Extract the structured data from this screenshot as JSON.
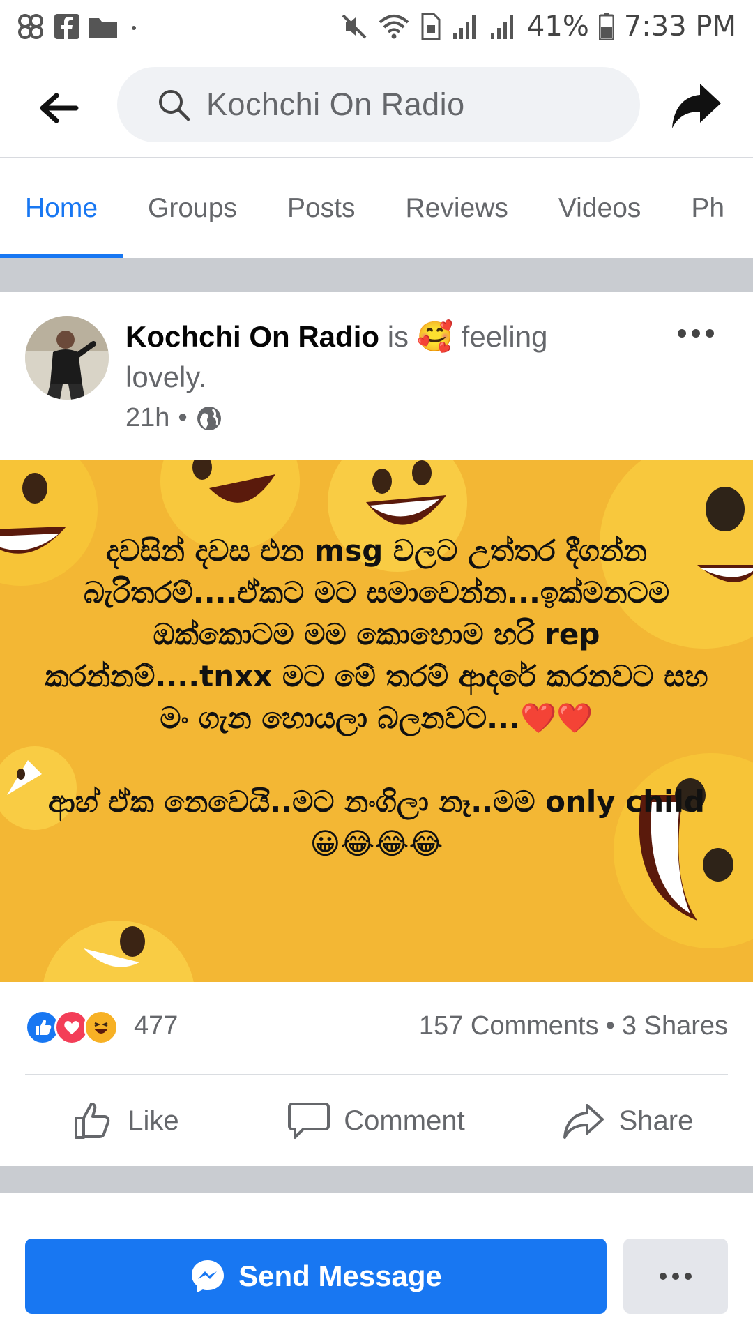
{
  "status_bar": {
    "battery_percent": "41%",
    "time": "7:33 PM",
    "icons": [
      "app-icon",
      "facebook-icon",
      "folder-icon",
      "dot-icon",
      "mute-icon",
      "wifi-icon",
      "sim-icon",
      "signal-icon",
      "signal-icon",
      "battery-icon"
    ]
  },
  "search": {
    "text": "Kochchi On Radio"
  },
  "tabs": [
    {
      "label": "Home",
      "active": true
    },
    {
      "label": "Groups",
      "active": false
    },
    {
      "label": "Posts",
      "active": false
    },
    {
      "label": "Reviews",
      "active": false
    },
    {
      "label": "Videos",
      "active": false
    },
    {
      "label": "Ph",
      "active": false
    }
  ],
  "post": {
    "author": "Kochchi On Radio",
    "is_text": "is",
    "feeling_emoji": "🥰",
    "feeling_text": "feeling lovely.",
    "time": "21h",
    "separator": "•",
    "privacy_icon": "globe-icon",
    "image_text": {
      "paragraph1": "දවසින් දවස එන msg වලට උත්තර දීගන්න බැරිතරම්....ඒකට මට සමාවෙන්න...ඉක්මනටම ඔක්කොටම මම කොහොම හරි rep කරන්නම්....tnxx මට මේ තරම් ආදරේ කරනවට සහ මං ගැන හොයලා බලනවට...❤️❤️",
      "paragraph2": "ආහ් ඒක නෙවෙයි..මට නංගිලා නෑ..මම only child 😀😂😂😂"
    },
    "reactions": {
      "count": "477",
      "icons": [
        "like-reaction-icon",
        "love-reaction-icon",
        "haha-reaction-icon"
      ]
    },
    "comments": "157 Comments",
    "dot": "•",
    "shares": "3 Shares",
    "actions": [
      {
        "label": "Like",
        "icon": "thumbs-up-icon"
      },
      {
        "label": "Comment",
        "icon": "comment-icon"
      },
      {
        "label": "Share",
        "icon": "share-icon"
      }
    ]
  },
  "cta": {
    "send_message": "Send Message",
    "messenger_icon": "messenger-icon",
    "more_icon": "more-dots-icon"
  },
  "colors": {
    "accent": "#1877f2",
    "image_bg": "#f3b734",
    "muted_text": "#65676b",
    "band": "#c9ccd1"
  }
}
